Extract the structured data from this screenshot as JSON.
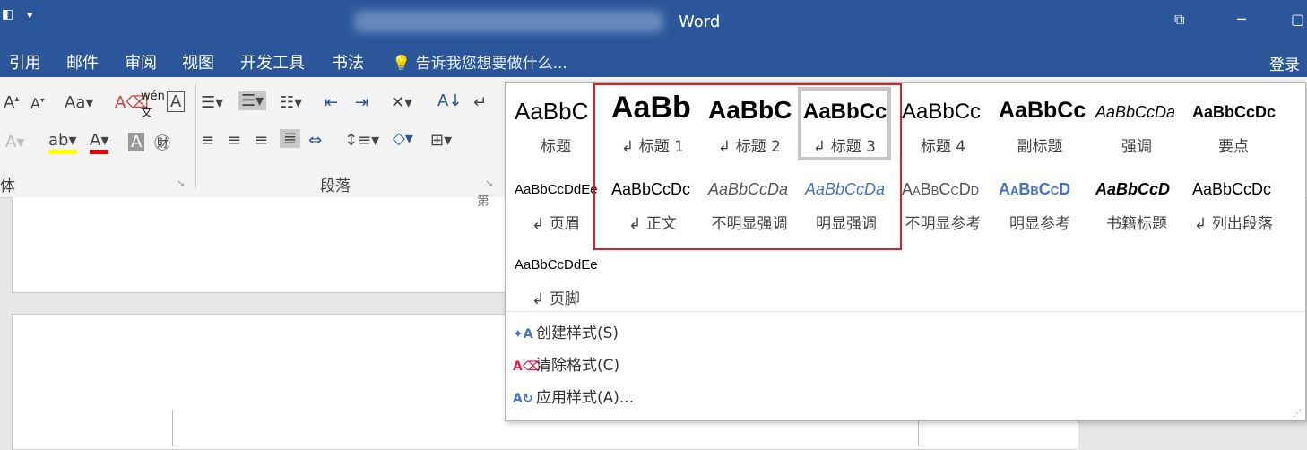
{
  "titlebar": {
    "app_title": "Word"
  },
  "tabs": [
    "引用",
    "邮件",
    "审阅",
    "视图",
    "开发工具",
    "书法"
  ],
  "tell_me": "告诉我您想要做什么...",
  "login": "登录",
  "ribbon": {
    "group_font_label_fragment": "体",
    "group_paragraph_label": "段落"
  },
  "doc": {
    "header_fragment": "第"
  },
  "styles": [
    {
      "preview": "AaBbC",
      "name": "标题"
    },
    {
      "preview": "AaBb",
      "name": "标题 1"
    },
    {
      "preview": "AaBbC",
      "name": "标题 2"
    },
    {
      "preview": "AaBbCc",
      "name": "标题 3",
      "selected": true
    },
    {
      "preview": "AaBbCc",
      "name": "标题 4"
    },
    {
      "preview": "AaBbCc",
      "name": "副标题"
    },
    {
      "preview": "AaBbCcDa",
      "name": "强调"
    },
    {
      "preview": "AaBbCcDc",
      "name": "要点"
    },
    {
      "preview": "AaBbCcDdEe",
      "name": "页眉"
    },
    {
      "preview": "AaBbCcDc",
      "name": "正文"
    },
    {
      "preview": "AaBbCcDa",
      "name": "不明显强调"
    },
    {
      "preview": "AaBbCcDa",
      "name": "明显强调"
    },
    {
      "preview": "AaBbCcDd",
      "name": "不明显参考"
    },
    {
      "preview": "AaBbCcD",
      "name": "明显参考"
    },
    {
      "preview": "AaBbCcD",
      "name": "书籍标题"
    },
    {
      "preview": "AaBbCcDc",
      "name": "列出段落"
    },
    {
      "preview": "AaBbCcDdEe",
      "name": "页脚"
    }
  ],
  "actions": [
    {
      "label": "创建样式(S)",
      "icon": "create-style-icon"
    },
    {
      "label": "清除格式(C)",
      "icon": "clear-format-icon"
    },
    {
      "label": "应用样式(A)...",
      "icon": "apply-style-icon"
    }
  ],
  "colors": {
    "titlebar": "#2b579a",
    "highlight_box": "#e01e26",
    "emphasis_blue": "#4472c4"
  }
}
